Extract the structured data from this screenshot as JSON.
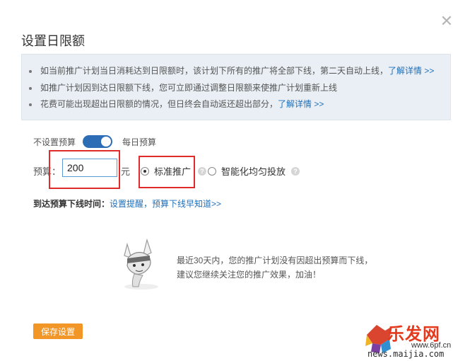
{
  "dialog": {
    "title": "设置日限额",
    "close_icon": "close-icon"
  },
  "notice": {
    "items": [
      {
        "text": "如当前推广计划当日消耗达到日限额时，该计划下所有的推广将全部下线，第二天自动上线，",
        "link": "了解详情 >>"
      },
      {
        "text": "如推广计划因到达日限额下线，您可立即通过调整日限额来使推广计划重新上线",
        "link": ""
      },
      {
        "text": "花费可能出现超出日限额的情况，但日终会自动返还超出部分，",
        "link": "了解详情 >>"
      }
    ]
  },
  "budget_mode": {
    "off_label": "不设置预算",
    "on_label": "每日预算",
    "enabled": true
  },
  "budget": {
    "label": "预算：",
    "value": "200",
    "unit": "元"
  },
  "delivery": {
    "options": [
      {
        "label": "标准推广",
        "checked": true
      },
      {
        "label": "智能化均匀投放",
        "checked": false
      }
    ]
  },
  "offline_time": {
    "label": "到达预算下线时间：",
    "link": "设置提醒，预算下线早知道>>"
  },
  "empty_state": {
    "line1": "最近30天内，您的推广计划没有因超出预算而下线，",
    "line2": "建议您继续关注您的推广效果，加油！"
  },
  "save_button": "保存设置",
  "watermark": {
    "brand": "乐发网",
    "site": "www.6pf.cn",
    "sub": "news.maijia.com"
  },
  "colors": {
    "accent": "#2d6db5",
    "link": "#1f6fb8",
    "save": "#f39628",
    "highlight_box": "#e02b2b"
  }
}
